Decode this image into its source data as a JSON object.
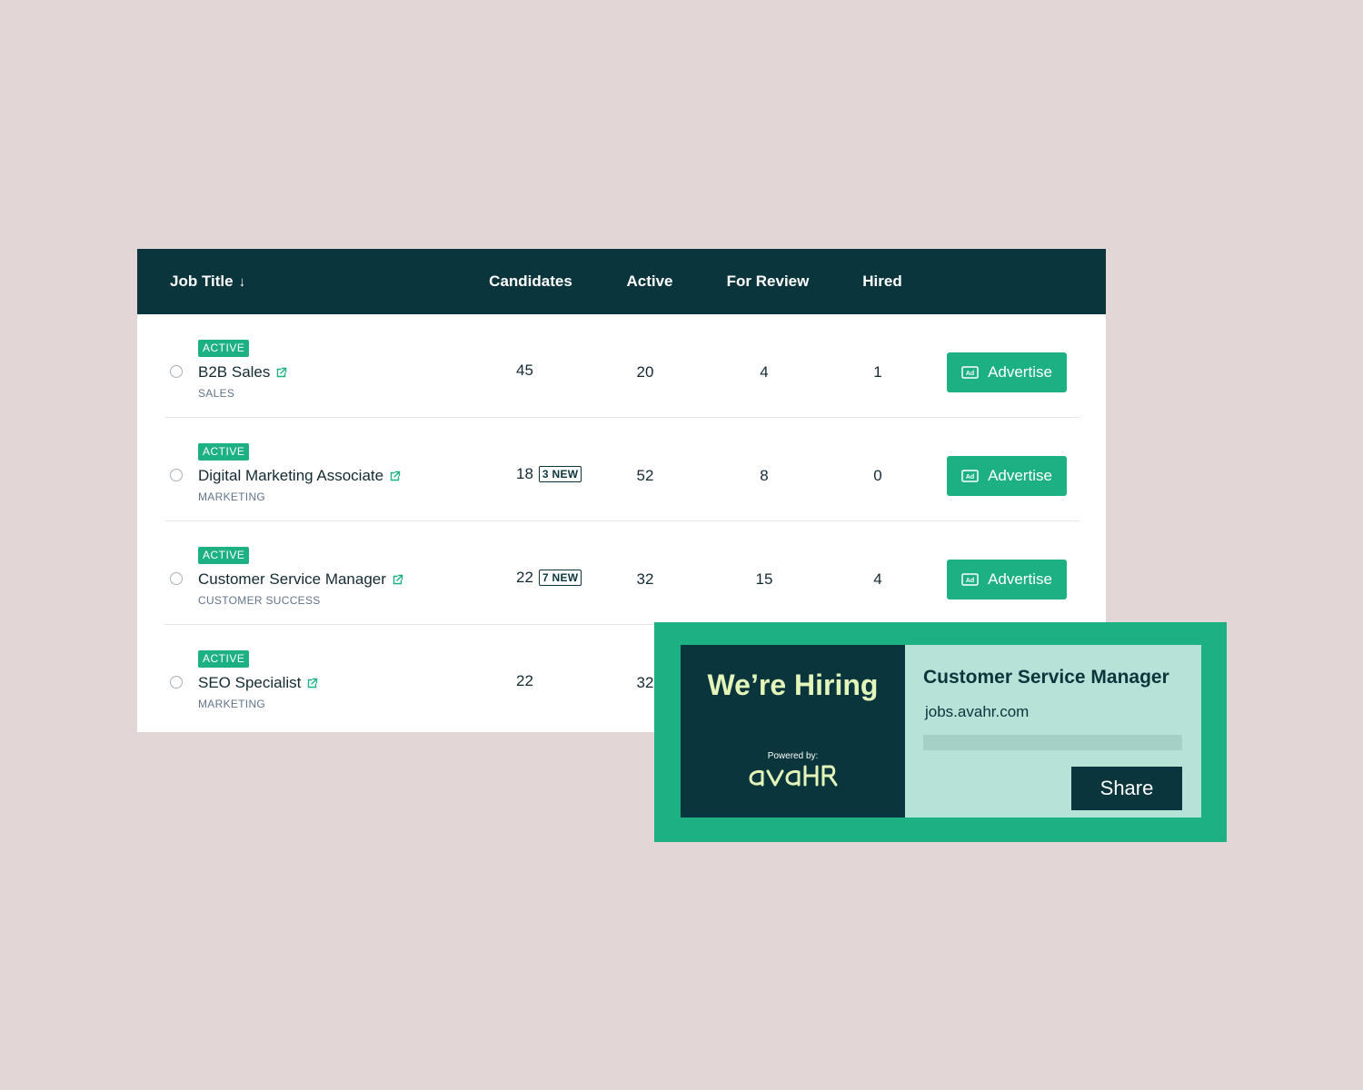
{
  "colors": {
    "background": "#e2d7d6",
    "header": "#0b353c",
    "accent": "#1db083",
    "banner_light": "#b6e2d7",
    "banner_title": "#e4f5b9",
    "department": "#617489"
  },
  "table": {
    "headers": {
      "job_title": "Job Title",
      "sort_icon": "arrow-down-icon",
      "candidates": "Candidates",
      "active": "Active",
      "for_review": "For Review",
      "hired": "Hired"
    },
    "rows": [
      {
        "status": "ACTIVE",
        "title": "B2B Sales",
        "department": "SALES",
        "candidates": "45",
        "new_badge": "",
        "active": "20",
        "for_review": "4",
        "hired": "1",
        "action": "Advertise"
      },
      {
        "status": "ACTIVE",
        "title": "Digital Marketing Associate",
        "department": "MARKETING",
        "candidates": "18",
        "new_badge": "3 NEW",
        "active": "52",
        "for_review": "8",
        "hired": "0",
        "action": "Advertise"
      },
      {
        "status": "ACTIVE",
        "title": "Customer Service Manager",
        "department": "CUSTOMER SUCCESS",
        "candidates": "22",
        "new_badge": "7 NEW",
        "active": "32",
        "for_review": "15",
        "hired": "4",
        "action": "Advertise"
      },
      {
        "status": "ACTIVE",
        "title": "SEO Specialist",
        "department": "MARKETING",
        "candidates": "22",
        "new_badge": "",
        "active": "32",
        "for_review": "",
        "hired": "",
        "action": ""
      }
    ]
  },
  "banner": {
    "headline": "We’re Hiring",
    "powered_by": "Powered by:",
    "brand": "avahr",
    "job_title": "Customer Service Manager",
    "url": "jobs.avahr.com",
    "share_label": "Share"
  }
}
